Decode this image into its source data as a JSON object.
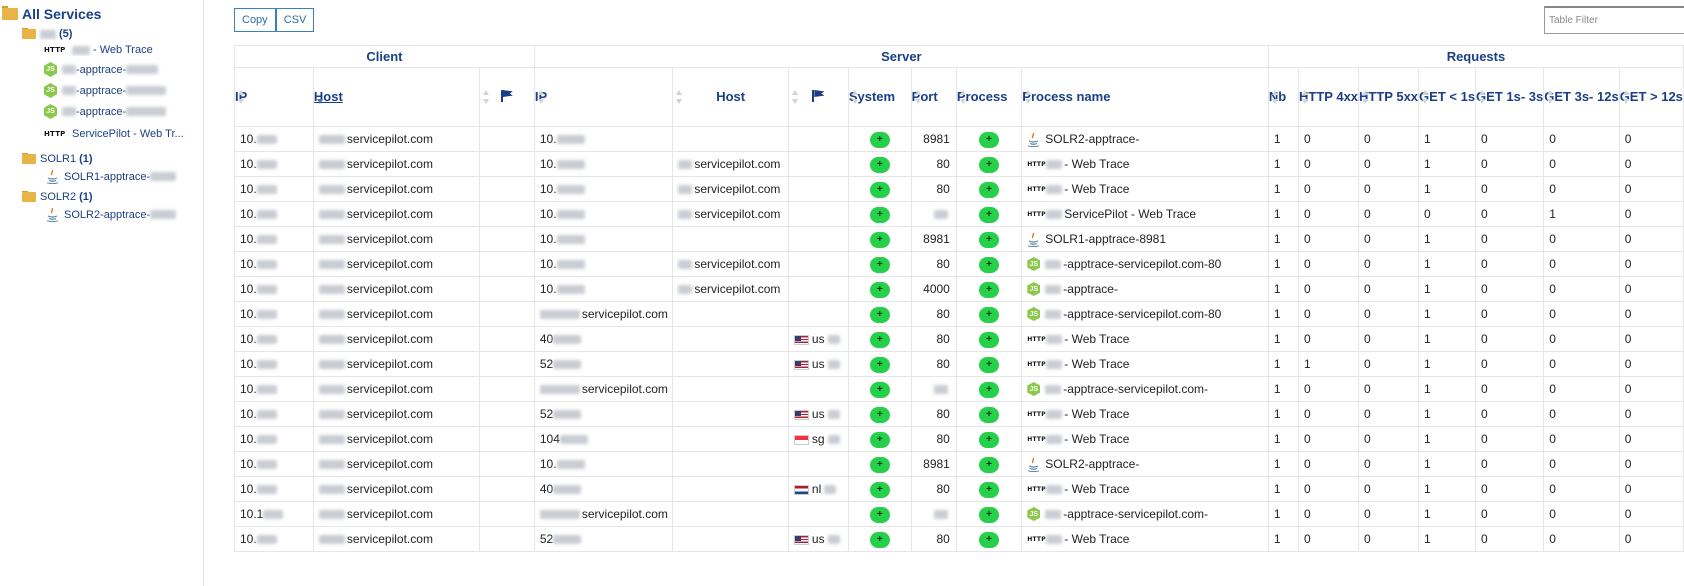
{
  "sidebar": {
    "root_label": "All Services",
    "groups": [
      {
        "label": "",
        "count": "(5)",
        "children": [
          {
            "icon": "http-icon",
            "label": "- Web Trace"
          },
          {
            "icon": "nodejs-icon",
            "label": "-apptrace-"
          },
          {
            "icon": "nodejs-icon",
            "label": "-apptrace-"
          },
          {
            "icon": "nodejs-icon",
            "label": "-apptrace-"
          },
          {
            "icon": "http-icon",
            "label": "ServicePilot - Web Tr..."
          }
        ]
      },
      {
        "label": "SOLR1",
        "count": "(1)",
        "children": [
          {
            "icon": "java-icon",
            "label": "SOLR1-apptrace-"
          }
        ]
      },
      {
        "label": "SOLR2",
        "count": "(1)",
        "children": [
          {
            "icon": "java-icon",
            "label": "SOLR2-apptrace-"
          }
        ]
      }
    ]
  },
  "toolbar": {
    "copy_label": "Copy",
    "csv_label": "CSV",
    "filter_placeholder": "Table Filter"
  },
  "table": {
    "groups": {
      "client": "Client",
      "server": "Server",
      "requests": "Requests"
    },
    "columns": {
      "client_ip": "IP",
      "client_host": "Host",
      "server_ip": "IP",
      "server_host": "Host",
      "system": "System",
      "port": "Port",
      "process": "Process",
      "process_name": "Process name",
      "nb": "Nb",
      "http4xx": "HTTP 4xx",
      "http5xx": "HTTP 5xx",
      "get_lt1": "GET < 1s",
      "get_1_3": "GET 1s- 3s",
      "get_3_12": "GET 3s- 12s",
      "get_gt12": "GET > 12s"
    },
    "system_badge": "+",
    "process_badge": "+",
    "rows": [
      {
        "client_ip": "10.",
        "client_host": "servicepilot.com",
        "server_ip": "10.",
        "server_host": "",
        "country": "",
        "port": "8981",
        "proc_icon": "java-icon",
        "proc_name": "SOLR2-apptrace-",
        "nb": "1",
        "h4": "0",
        "h5": "0",
        "g1": "1",
        "g2": "0",
        "g3": "0",
        "g4": "0"
      },
      {
        "client_ip": "10.",
        "client_host": "servicepilot.com",
        "server_ip": "10.",
        "server_host": "servicepilot.com",
        "country": "",
        "port": "80",
        "proc_icon": "http-icon",
        "proc_name": "- Web Trace",
        "nb": "1",
        "h4": "0",
        "h5": "0",
        "g1": "1",
        "g2": "0",
        "g3": "0",
        "g4": "0"
      },
      {
        "client_ip": "10.",
        "client_host": "servicepilot.com",
        "server_ip": "10.",
        "server_host": "servicepilot.com",
        "country": "",
        "port": "80",
        "proc_icon": "http-icon",
        "proc_name": "- Web Trace",
        "nb": "1",
        "h4": "0",
        "h5": "0",
        "g1": "1",
        "g2": "0",
        "g3": "0",
        "g4": "0"
      },
      {
        "client_ip": "10.",
        "client_host": "servicepilot.com",
        "server_ip": "10.",
        "server_host": "servicepilot.com",
        "country": "",
        "port": "",
        "proc_icon": "http-icon",
        "proc_name": "ServicePilot - Web Trace",
        "nb": "1",
        "h4": "0",
        "h5": "0",
        "g1": "0",
        "g2": "0",
        "g3": "1",
        "g4": "0"
      },
      {
        "client_ip": "10.",
        "client_host": "servicepilot.com",
        "server_ip": "10.",
        "server_host": "",
        "country": "",
        "port": "8981",
        "proc_icon": "java-icon",
        "proc_name": "SOLR1-apptrace-8981",
        "nb": "1",
        "h4": "0",
        "h5": "0",
        "g1": "1",
        "g2": "0",
        "g3": "0",
        "g4": "0"
      },
      {
        "client_ip": "10.",
        "client_host": "servicepilot.com",
        "server_ip": "10.",
        "server_host": "servicepilot.com",
        "country": "",
        "port": "80",
        "proc_icon": "nodejs-icon",
        "proc_name": "-apptrace-servicepilot.com-80",
        "nb": "1",
        "h4": "0",
        "h5": "0",
        "g1": "1",
        "g2": "0",
        "g3": "0",
        "g4": "0"
      },
      {
        "client_ip": "10.",
        "client_host": "servicepilot.com",
        "server_ip": "10.",
        "server_host": "servicepilot.com",
        "country": "",
        "port": "4000",
        "proc_icon": "nodejs-icon",
        "proc_name": "-apptrace-",
        "nb": "1",
        "h4": "0",
        "h5": "0",
        "g1": "1",
        "g2": "0",
        "g3": "0",
        "g4": "0"
      },
      {
        "client_ip": "10.",
        "client_host": "servicepilot.com",
        "server_ip": "servicepilot.com",
        "server_host": "",
        "country": "",
        "port": "80",
        "proc_icon": "nodejs-icon",
        "proc_name": "-apptrace-servicepilot.com-80",
        "nb": "1",
        "h4": "0",
        "h5": "0",
        "g1": "1",
        "g2": "0",
        "g3": "0",
        "g4": "0"
      },
      {
        "client_ip": "10.",
        "client_host": "servicepilot.com",
        "server_ip": "40",
        "server_host": "",
        "country": "us",
        "port": "80",
        "proc_icon": "http-icon",
        "proc_name": "- Web Trace",
        "nb": "1",
        "h4": "0",
        "h5": "0",
        "g1": "1",
        "g2": "0",
        "g3": "0",
        "g4": "0"
      },
      {
        "client_ip": "10.",
        "client_host": "servicepilot.com",
        "server_ip": "52",
        "server_host": "",
        "country": "us",
        "port": "80",
        "proc_icon": "http-icon",
        "proc_name": "- Web Trace",
        "nb": "1",
        "h4": "1",
        "h5": "0",
        "g1": "1",
        "g2": "0",
        "g3": "0",
        "g4": "0"
      },
      {
        "client_ip": "10.",
        "client_host": "servicepilot.com",
        "server_ip": "servicepilot.com",
        "server_host": "",
        "country": "",
        "port": "",
        "proc_icon": "nodejs-icon",
        "proc_name": "-apptrace-servicepilot.com-",
        "nb": "1",
        "h4": "0",
        "h5": "0",
        "g1": "1",
        "g2": "0",
        "g3": "0",
        "g4": "0"
      },
      {
        "client_ip": "10.",
        "client_host": "servicepilot.com",
        "server_ip": "52",
        "server_host": "",
        "country": "us",
        "port": "80",
        "proc_icon": "http-icon",
        "proc_name": "- Web Trace",
        "nb": "1",
        "h4": "0",
        "h5": "0",
        "g1": "1",
        "g2": "0",
        "g3": "0",
        "g4": "0"
      },
      {
        "client_ip": "10.",
        "client_host": "servicepilot.com",
        "server_ip": "104",
        "server_host": "",
        "country": "sg",
        "port": "80",
        "proc_icon": "http-icon",
        "proc_name": "- Web Trace",
        "nb": "1",
        "h4": "0",
        "h5": "0",
        "g1": "1",
        "g2": "0",
        "g3": "0",
        "g4": "0"
      },
      {
        "client_ip": "10.",
        "client_host": "servicepilot.com",
        "server_ip": "10.",
        "server_host": "",
        "country": "",
        "port": "8981",
        "proc_icon": "java-icon",
        "proc_name": "SOLR2-apptrace-",
        "nb": "1",
        "h4": "0",
        "h5": "0",
        "g1": "1",
        "g2": "0",
        "g3": "0",
        "g4": "0"
      },
      {
        "client_ip": "10.",
        "client_host": "servicepilot.com",
        "server_ip": "40",
        "server_host": "",
        "country": "nl",
        "port": "80",
        "proc_icon": "http-icon",
        "proc_name": "- Web Trace",
        "nb": "1",
        "h4": "0",
        "h5": "0",
        "g1": "1",
        "g2": "0",
        "g3": "0",
        "g4": "0"
      },
      {
        "client_ip": "10.1",
        "client_host": "servicepilot.com",
        "server_ip": "servicepilot.com",
        "server_host": "",
        "country": "",
        "port": "",
        "proc_icon": "nodejs-icon",
        "proc_name": "-apptrace-servicepilot.com-",
        "nb": "1",
        "h4": "0",
        "h5": "0",
        "g1": "1",
        "g2": "0",
        "g3": "0",
        "g4": "0"
      },
      {
        "client_ip": "10.",
        "client_host": "servicepilot.com",
        "server_ip": "52",
        "server_host": "",
        "country": "us",
        "port": "80",
        "proc_icon": "http-icon",
        "proc_name": "- Web Trace",
        "nb": "1",
        "h4": "0",
        "h5": "0",
        "g1": "1",
        "g2": "0",
        "g3": "0",
        "g4": "0"
      }
    ]
  },
  "colors": {
    "accent": "#1b3f86",
    "badge_green": "#27d04b",
    "error_magenta": "#d64bd6"
  }
}
